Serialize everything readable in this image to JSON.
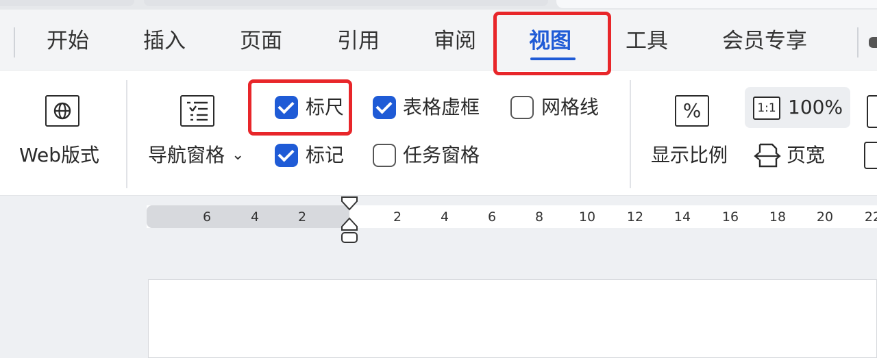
{
  "tabs": [
    {
      "label": "开始"
    },
    {
      "label": "插入"
    },
    {
      "label": "页面"
    },
    {
      "label": "引用"
    },
    {
      "label": "审阅"
    },
    {
      "label": "视图",
      "active": true
    },
    {
      "label": "工具"
    },
    {
      "label": "会员专享"
    }
  ],
  "ribbon": {
    "web_layout": {
      "label": "Web版式",
      "icon": "globe-icon"
    },
    "nav_pane": {
      "label": "导航窗格",
      "icon": "list-icon",
      "dropdown_glyph": "⌄"
    },
    "checkboxes": {
      "ruler": {
        "label": "标尺",
        "checked": true
      },
      "table_gridlines": {
        "label": "表格虚框",
        "checked": true
      },
      "gridlines": {
        "label": "网格线",
        "checked": false
      },
      "marks": {
        "label": "标记",
        "checked": true
      },
      "task_pane": {
        "label": "任务窗格",
        "checked": false
      }
    },
    "zoom": {
      "label": "显示比例",
      "icon": "percent-icon",
      "glyph": "%"
    },
    "zoom_100": {
      "label": "100%",
      "icon": "one-to-one-icon",
      "glyph": "1:1"
    },
    "page_width": {
      "label": "页宽",
      "icon": "page-width-icon"
    }
  },
  "ruler": {
    "left_ticks": [
      "6",
      "4",
      "2"
    ],
    "right_ticks": [
      "2",
      "4",
      "6",
      "8",
      "10",
      "12",
      "14",
      "16",
      "18",
      "20",
      "22"
    ]
  },
  "colors": {
    "accent": "#1f5bd6",
    "highlight": "#e8262a"
  }
}
